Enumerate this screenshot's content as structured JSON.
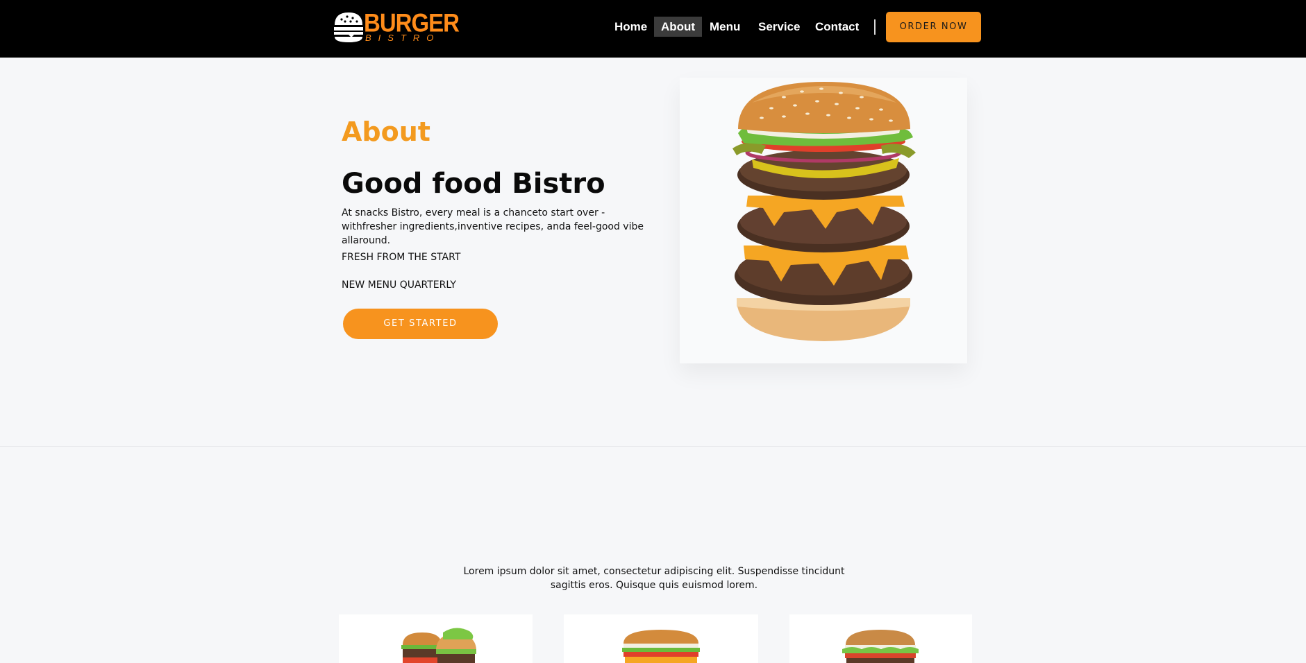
{
  "header": {
    "logo": {
      "main": "BURGER",
      "sub": "BISTRO"
    },
    "nav": [
      {
        "label": "Home",
        "active": false
      },
      {
        "label": "About",
        "active": true
      },
      {
        "label": "Menu",
        "active": false
      },
      {
        "label": "Service",
        "active": false
      },
      {
        "label": "Contact",
        "active": false
      }
    ],
    "order_button": "ORDER NOW"
  },
  "hero": {
    "eyebrow": "About",
    "title": "Good food Bistro",
    "description": "At snacks Bistro, every meal is a chanceto start over - withfresher ingredients,inventive recipes, anda feel-good vibe allaround.",
    "features": [
      "FRESH FROM THE START",
      "NEW MENU QUARTERLY"
    ],
    "cta": "GET STARTED",
    "image_icon": "stacked-burger-image"
  },
  "section2": {
    "intro": "Lorem ipsum dolor sit amet, consectetur adipiscing elit. Suspendisse tincidunt sagittis eros. Quisque quis euismod lorem.",
    "cards": [
      {
        "image_icon": "burger-pair-image"
      },
      {
        "image_icon": "cheeseburger-image"
      },
      {
        "image_icon": "veggie-burger-image"
      }
    ]
  },
  "colors": {
    "accent": "#f7931e",
    "eyebrow": "#f39a1f",
    "header_bg": "#000000",
    "page_bg": "#f6f7f9"
  }
}
